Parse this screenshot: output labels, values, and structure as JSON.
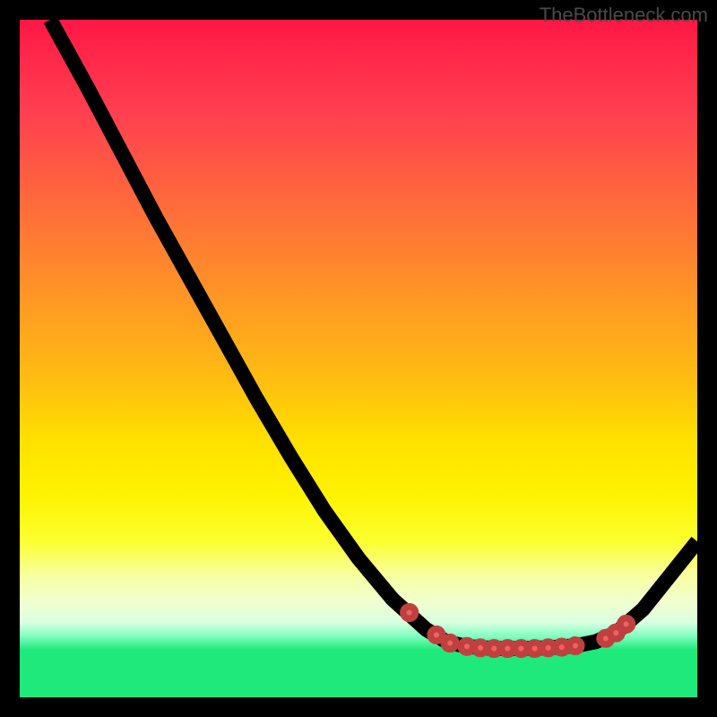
{
  "watermark": "TheBottleneck.com",
  "chart_data": {
    "type": "line",
    "title": "",
    "xlabel": "",
    "ylabel": "",
    "xlim": [
      0,
      100
    ],
    "ylim": [
      0,
      100
    ],
    "curve": [
      {
        "x": 4.5,
        "y": 100
      },
      {
        "x": 10,
        "y": 90
      },
      {
        "x": 15,
        "y": 80.5
      },
      {
        "x": 20,
        "y": 71
      },
      {
        "x": 25,
        "y": 62
      },
      {
        "x": 30,
        "y": 53
      },
      {
        "x": 35,
        "y": 44
      },
      {
        "x": 40,
        "y": 35.5
      },
      {
        "x": 45,
        "y": 27.5
      },
      {
        "x": 50,
        "y": 20.5
      },
      {
        "x": 55,
        "y": 14.5
      },
      {
        "x": 60,
        "y": 10
      },
      {
        "x": 63,
        "y": 8.2
      },
      {
        "x": 66,
        "y": 7.5
      },
      {
        "x": 70,
        "y": 7.2
      },
      {
        "x": 74,
        "y": 7.2
      },
      {
        "x": 78,
        "y": 7.3
      },
      {
        "x": 82,
        "y": 7.6
      },
      {
        "x": 85,
        "y": 8.2
      },
      {
        "x": 88,
        "y": 9.5
      },
      {
        "x": 92,
        "y": 13
      },
      {
        "x": 96,
        "y": 18
      },
      {
        "x": 100,
        "y": 23
      }
    ],
    "markers": [
      {
        "x": 57.5,
        "y": 12.5
      },
      {
        "x": 61.5,
        "y": 9.2
      },
      {
        "x": 63.5,
        "y": 8.0
      },
      {
        "x": 66,
        "y": 7.5
      },
      {
        "x": 68,
        "y": 7.3
      },
      {
        "x": 70,
        "y": 7.2
      },
      {
        "x": 72,
        "y": 7.2
      },
      {
        "x": 74,
        "y": 7.2
      },
      {
        "x": 76,
        "y": 7.2
      },
      {
        "x": 78,
        "y": 7.3
      },
      {
        "x": 80,
        "y": 7.4
      },
      {
        "x": 82,
        "y": 7.6
      },
      {
        "x": 86.5,
        "y": 8.7
      },
      {
        "x": 88,
        "y": 9.5
      },
      {
        "x": 89.5,
        "y": 10.8
      }
    ],
    "gradient_colors": {
      "top": "#ff1744",
      "mid_upper": "#ff8030",
      "mid": "#ffe000",
      "mid_lower": "#fcff30",
      "bottom": "#20e97b"
    }
  }
}
